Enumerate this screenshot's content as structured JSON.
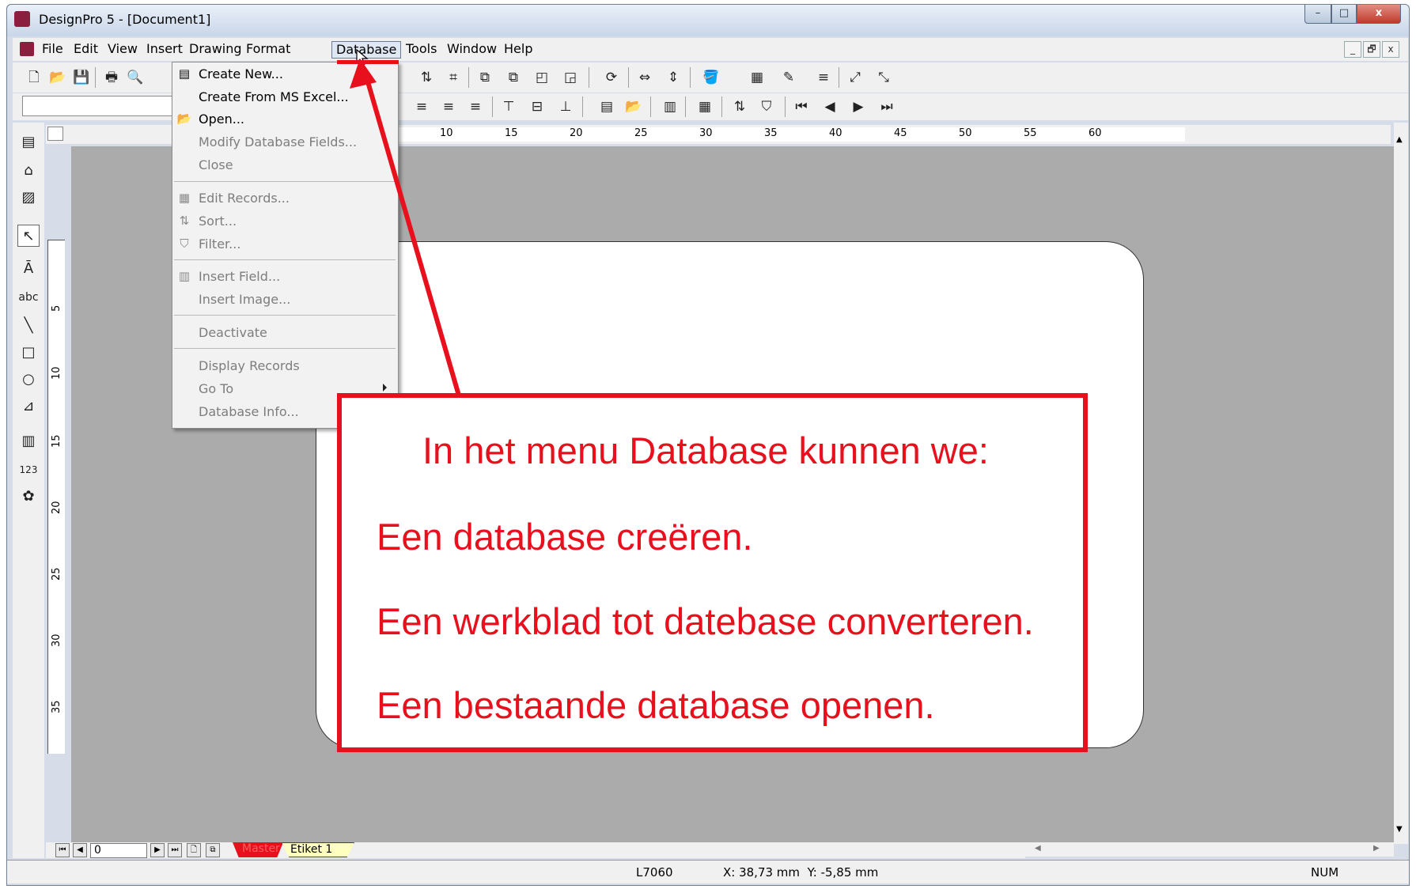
{
  "window": {
    "title": "DesignPro 5 - [Document1]",
    "controls": {
      "minimize": "–",
      "maximize": "□",
      "close": "x"
    }
  },
  "menubar": {
    "items": [
      "File",
      "Edit",
      "View",
      "Insert",
      "Drawing",
      "Format",
      "Database",
      "Tools",
      "Window",
      "Help"
    ],
    "active": "Database",
    "mdi_controls": [
      "_",
      "🗗",
      "x"
    ]
  },
  "database_menu": {
    "items": [
      {
        "label": "Create New...",
        "icon": "create-database-icon",
        "enabled": true
      },
      {
        "label": "Create From MS Excel...",
        "icon": "",
        "enabled": true
      },
      {
        "label": "Open...",
        "icon": "open-folder-icon",
        "enabled": true
      },
      {
        "label": "Modify Database Fields...",
        "icon": "",
        "enabled": false
      },
      {
        "label": "Close",
        "icon": "",
        "enabled": false
      },
      {
        "label": "Edit Records...",
        "icon": "edit-records-icon",
        "enabled": false
      },
      {
        "label": "Sort...",
        "icon": "sort-icon",
        "enabled": false
      },
      {
        "label": "Filter...",
        "icon": "filter-icon",
        "enabled": false
      },
      {
        "label": "Insert Field...",
        "icon": "insert-field-icon",
        "enabled": false
      },
      {
        "label": "Insert Image...",
        "icon": "",
        "enabled": false
      },
      {
        "label": "Deactivate",
        "icon": "",
        "enabled": false
      },
      {
        "label": "Display Records",
        "icon": "",
        "enabled": false,
        "submenu": true
      },
      {
        "label": "Go To",
        "icon": "",
        "enabled": false
      },
      {
        "label": "Database Info...",
        "icon": "",
        "enabled": false
      }
    ]
  },
  "ruler": {
    "horizontal": [
      "10",
      "15",
      "20",
      "25",
      "30",
      "35",
      "40",
      "45",
      "50",
      "55",
      "60"
    ],
    "vertical": [
      "5",
      "10",
      "15",
      "20",
      "25",
      "30",
      "35"
    ]
  },
  "page_nav": {
    "page_number": "0",
    "tabs": [
      "Master",
      "Etiket 1"
    ]
  },
  "statusbar": {
    "label_type": "L7060",
    "coordinates": "X: 38,73 mm  Y: -5,85 mm",
    "num_lock": "NUM"
  },
  "annotation": {
    "heading": "In het menu Database kunnen we:",
    "lines": [
      "Een database creëren.",
      "Een werkblad tot datebase converteren.",
      "Een bestaande database openen."
    ],
    "color": "#e8101d"
  }
}
